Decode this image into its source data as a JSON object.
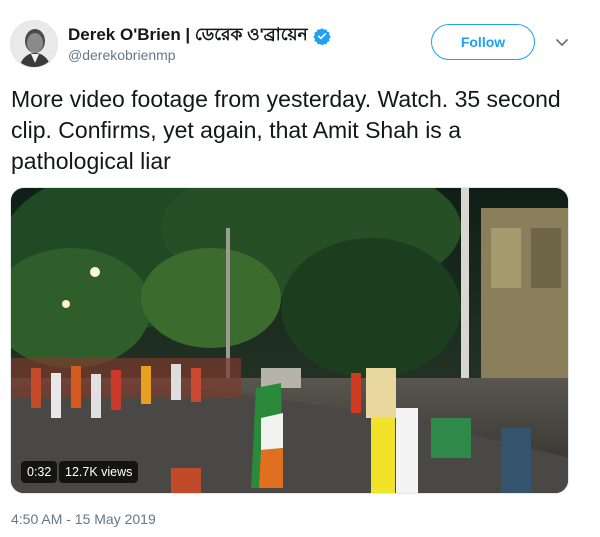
{
  "author": {
    "display_name": "Derek O'Brien | ডেরেক ও'ব্রায়েন",
    "handle": "@derekobrienmp",
    "verified_icon": "verified-badge-icon"
  },
  "follow_button": {
    "label": "Follow"
  },
  "menu": {
    "icon": "chevron-down-icon"
  },
  "tweet": {
    "text": "More video footage from yesterday. Watch. 35 second clip. Confirms, yet again, that Amit Shah is a pathological liar"
  },
  "video": {
    "duration": "0:32",
    "views": "12.7K views"
  },
  "timestamp": "4:50 AM - 15 May 2019",
  "colors": {
    "accent": "#1da1f2",
    "secondary_text": "#657786",
    "primary_text": "#14171a"
  }
}
